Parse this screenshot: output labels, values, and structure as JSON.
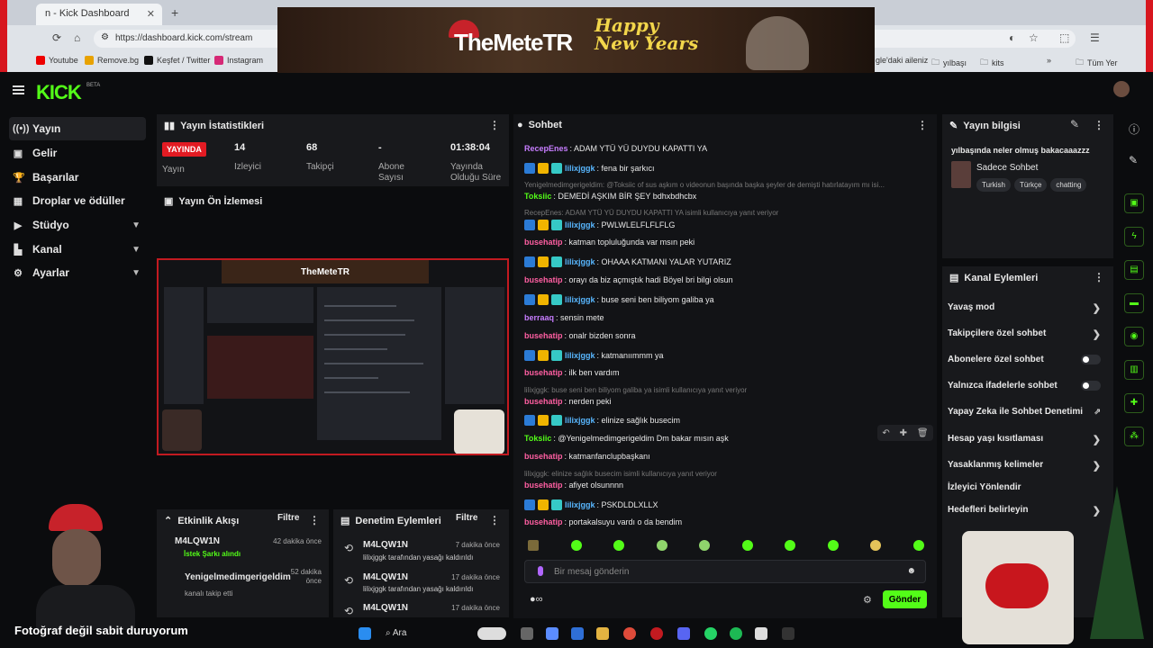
{
  "browser": {
    "tab_title": "n - Kick Dashboard",
    "url": "https://dashboard.kick.com/stream",
    "bookmarks": [
      "Youtube",
      "Remove.bg",
      "Keşfet / Twitter",
      "Instagram",
      "gle'daki aileniz",
      "yılbaşı",
      "kits",
      "Tüm Yer"
    ]
  },
  "banner": {
    "logo": "TheMeteTR",
    "greeting_1": "Happy",
    "greeting_2": "New Years"
  },
  "kick": {
    "logo": "KICK",
    "beta": "BETA"
  },
  "sidebar": {
    "items": [
      {
        "label": "Yayın",
        "icon": "broadcast-icon"
      },
      {
        "label": "Gelir",
        "icon": "revenue-icon"
      },
      {
        "label": "Başarılar",
        "icon": "trophy-icon"
      },
      {
        "label": "Droplar ve ödüller",
        "icon": "gift-icon"
      },
      {
        "label": "Stüdyo",
        "icon": "studio-icon"
      },
      {
        "label": "Kanal",
        "icon": "channel-icon"
      },
      {
        "label": "Ayarlar",
        "icon": "gear-icon"
      }
    ]
  },
  "stats": {
    "title": "Yayın İstatistikleri",
    "live_badge": "YAYINDA",
    "live_label": "Yayın",
    "viewers_value": "14",
    "viewers_label": "İzleyici",
    "followers_value": "68",
    "followers_label": "Takipçi",
    "subs_value": "-",
    "subs_label": "Abone Sayısı",
    "uptime_value": "01:38:04",
    "uptime_label": "Yayında Olduğu Süre"
  },
  "preview": {
    "title": "Yayın Ön İzlemesi",
    "banner": "TheMeteTR"
  },
  "activity": {
    "title": "Etkinlik Akışı",
    "filter": "Filtre",
    "items": [
      {
        "user": "M4LQW1N",
        "sub": "İstek Şarkı alındı",
        "time": "42 dakika önce"
      },
      {
        "user": "Yenigelmedimgerigeldim",
        "sub": "kanalı takip etti",
        "time": "52 dakika önce"
      }
    ]
  },
  "moderation": {
    "title": "Denetim Eylemleri",
    "filter": "Filtre",
    "items": [
      {
        "user": "M4LQW1N",
        "sub": "lilixjggk tarafından yasağı kaldırıldı",
        "time": "7 dakika önce"
      },
      {
        "user": "M4LQW1N",
        "sub": "lilixjggk tarafından yasağı kaldırıldı",
        "time": "17 dakika önce"
      },
      {
        "user": "M4LQW1N",
        "sub": "",
        "time": "17 dakika önce"
      }
    ]
  },
  "chat": {
    "title": "Sohbet",
    "messages": [
      {
        "user": "RecepEnes",
        "text": ": ADAM YTÜ YÜ DUYDU KAPATTI YA",
        "color": "#c77dff",
        "badges": false
      },
      {
        "user": "lilixjggk",
        "text": ": fena bir şarkıcı",
        "color": "#58b7ff",
        "badges": true
      },
      {
        "reply": "Yenigelmedimgerigeldim: @Toksiic of sus aşkım o videonun başında başka şeyler de demişti hatırlatayım mı isi..."
      },
      {
        "user": "Toksiic",
        "text": ": DEMEDİ AŞKIM BİR ŞEY bdhxbdhcbx",
        "color": "#53fc18",
        "badges": false
      },
      {
        "reply": "RecepEnes: ADAM YTÜ YÜ DUYDU KAPATTI YA isimli kullanıcıya yanıt veriyor"
      },
      {
        "user": "lilixjggk",
        "text": ": PWLWLELFLFLFLG",
        "color": "#58b7ff",
        "badges": true
      },
      {
        "user": "busehatip",
        "text": ": katman topluluğunda var msın peki",
        "color": "#ff5fa2",
        "badges": false
      },
      {
        "user": "lilixjggk",
        "text": ": OHAAA KATMANI YALAR YUTARIZ",
        "color": "#58b7ff",
        "badges": true
      },
      {
        "user": "busehatip",
        "text": ": orayı da biz açmıştık hadi Böyel bri bilgi olsun",
        "color": "#ff5fa2",
        "badges": false
      },
      {
        "user": "lilixjggk",
        "text": ": buse seni ben biliyom galiba ya",
        "color": "#58b7ff",
        "badges": true
      },
      {
        "user": "berraaq",
        "text": ": sensin mete",
        "color": "#c77dff",
        "badges": false
      },
      {
        "user": "busehatip",
        "text": ": onalr bizden sonra",
        "color": "#ff5fa2",
        "badges": false
      },
      {
        "user": "lilixjggk",
        "text": ": katmanıımmm ya",
        "color": "#58b7ff",
        "badges": true
      },
      {
        "user": "busehatip",
        "text": ": ilk ben vardım",
        "color": "#ff5fa2",
        "badges": false
      },
      {
        "reply": "lilixjggk: buse seni ben biliyom galiba ya isimli kullanıcıya yanıt veriyor"
      },
      {
        "user": "busehatip",
        "text": ": nerden peki",
        "color": "#ff5fa2",
        "badges": false
      },
      {
        "user": "lilixjggk",
        "text": ": elinize sağlık busecim",
        "color": "#58b7ff",
        "badges": true
      },
      {
        "user": "Toksiic",
        "text": ": @Yenigelmedimgerigeldim Dm bakar mısın aşk",
        "color": "#53fc18",
        "badges": false
      },
      {
        "user": "busehatip",
        "text": ": katmanfanclupbaşkanı",
        "color": "#ff5fa2",
        "badges": false
      },
      {
        "reply": "lilixjggk: elinize sağlık busecim isimli kullanıcıya yanıt veriyor"
      },
      {
        "user": "busehatip",
        "text": ": afiyet olsunnnn",
        "color": "#ff5fa2",
        "badges": false
      },
      {
        "user": "lilixjggk",
        "text": ": PSKDLDLXLLX",
        "color": "#58b7ff",
        "badges": true
      },
      {
        "user": "busehatip",
        "text": ": portakalsuyu vardı o da bendim",
        "color": "#ff5fa2",
        "badges": false
      }
    ],
    "input_placeholder": "Bir mesaj gönderin",
    "send_label": "Gönder"
  },
  "stream_info": {
    "title": "Yayın bilgisi",
    "stream_title": "yılbaşında neler olmuş bakacaaazzz",
    "category": "Sadece Sohbet",
    "tags": [
      "Turkish",
      "Türkçe",
      "chatting"
    ]
  },
  "channel_actions": {
    "title": "Kanal Eylemleri",
    "items": [
      {
        "label": "Yavaş mod",
        "control": "chevron"
      },
      {
        "label": "Takipçilere özel sohbet",
        "control": "chevron"
      },
      {
        "label": "Abonelere özel sohbet",
        "control": "toggle"
      },
      {
        "label": "Yalnızca ifadelerle sohbet",
        "control": "toggle"
      },
      {
        "label": "Yapay Zeka ile Sohbet Denetimi",
        "control": "external"
      },
      {
        "label": "Hesap yaşı kısıtlaması",
        "control": "chevron"
      },
      {
        "label": "Yasaklanmış kelimeler",
        "control": "chevron"
      },
      {
        "label": "İzleyici Yönlendir",
        "control": "none"
      },
      {
        "label": "Hedefleri belirleyin",
        "control": "chevron"
      }
    ]
  },
  "overlay": {
    "caption": "Fotoğraf değil sabit duruyorum"
  },
  "taskbar": {
    "search": "Ara"
  },
  "colors": {
    "kick_green": "#53fc18",
    "live_red": "#e31b23",
    "panel": "#18191c",
    "background": "#0b0c0e"
  }
}
